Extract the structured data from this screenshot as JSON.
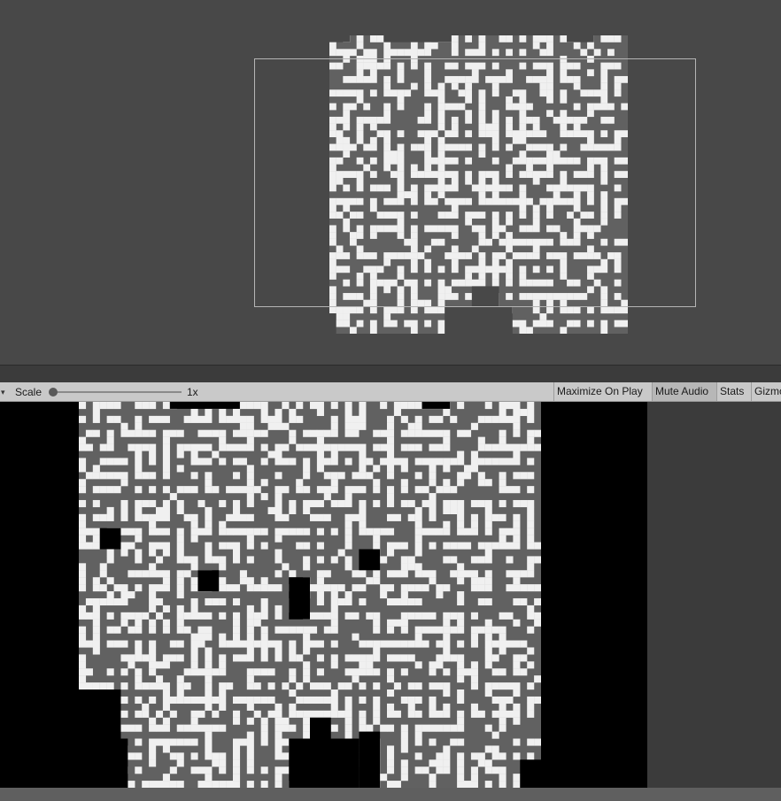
{
  "colors": {
    "maze_floor": "#616161",
    "maze_wall": "#f0f0f0",
    "game_background": "#000000",
    "scene_background": "#484848",
    "toolbar_background": "#c9c9c9"
  },
  "toolbar": {
    "scale_label": "Scale",
    "scale_value": "1x",
    "maximize_on_play": "Maximize On Play",
    "mute_audio": "Mute Audio",
    "stats": "Stats",
    "gizmos": "Gizmos"
  }
}
